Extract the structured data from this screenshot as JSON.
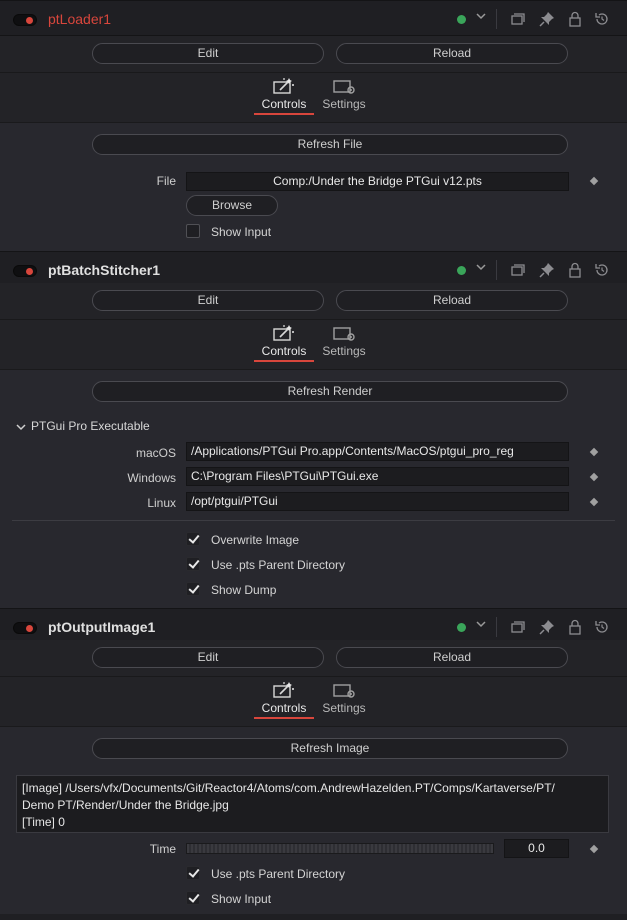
{
  "nodes": [
    {
      "title": "ptLoader1",
      "edit_label": "Edit",
      "reload_label": "Reload",
      "tab_controls": "Controls",
      "tab_settings": "Settings",
      "refresh_label": "Refresh File",
      "file_label": "File",
      "file_value": "Comp:/Under the Bridge PTGui v12.pts",
      "browse_label": "Browse",
      "show_input_label": "Show Input",
      "show_input_checked": false
    },
    {
      "title": "ptBatchStitcher1",
      "edit_label": "Edit",
      "reload_label": "Reload",
      "tab_controls": "Controls",
      "tab_settings": "Settings",
      "refresh_label": "Refresh Render",
      "group_label": "PTGui Pro Executable",
      "macos_label": "macOS",
      "macos_value": "/Applications/PTGui Pro.app/Contents/MacOS/ptgui_pro_reg",
      "windows_label": "Windows",
      "windows_value": "C:\\Program Files\\PTGui\\PTGui.exe",
      "linux_label": "Linux",
      "linux_value": "/opt/ptgui/PTGui",
      "overwrite_label": "Overwrite Image",
      "use_pts_label": "Use .pts Parent Directory",
      "show_dump_label": "Show Dump"
    },
    {
      "title": "ptOutputImage1",
      "edit_label": "Edit",
      "reload_label": "Reload",
      "tab_controls": "Controls",
      "tab_settings": "Settings",
      "refresh_label": "Refresh Image",
      "text_line1": "[Image] /Users/vfx/Documents/Git/Reactor4/Atoms/com.AndrewHazelden.PT/Comps/Kartaverse/PT/",
      "text_line2": "Demo PT/Render/Under the Bridge.jpg",
      "text_line3": "[Time] 0",
      "time_label": "Time",
      "time_value": "0.0",
      "use_pts_label": "Use .pts Parent Directory",
      "show_input_label": "Show Input"
    }
  ],
  "colors": {
    "accent": "#d8463c",
    "status_green": "#3aa55a"
  }
}
